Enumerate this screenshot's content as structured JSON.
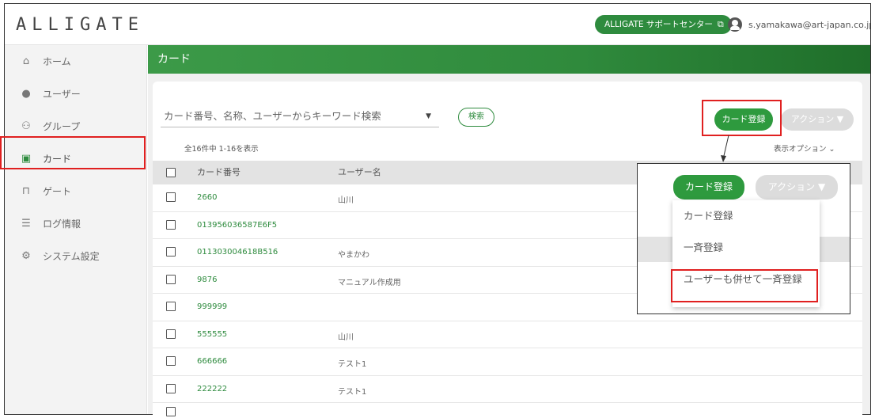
{
  "header": {
    "logo": "ALLIGATE",
    "support_label": "ALLIGATE サポートセンター",
    "user_email": "s.yamakawa@art-japan.co.jp"
  },
  "sidebar": {
    "items": [
      {
        "label": "ホーム",
        "icon": "home-icon"
      },
      {
        "label": "ユーザー",
        "icon": "user-icon"
      },
      {
        "label": "グループ",
        "icon": "group-icon"
      },
      {
        "label": "カード",
        "icon": "card-icon"
      },
      {
        "label": "ゲート",
        "icon": "gate-icon"
      },
      {
        "label": "ログ情報",
        "icon": "list-icon"
      },
      {
        "label": "システム設定",
        "icon": "gear-icon"
      }
    ],
    "active_index": 3
  },
  "page": {
    "title": "カード",
    "search_placeholder": "カード番号、名称、ユーザーからキーワード検索",
    "search_button": "検索",
    "register_button": "カード登録",
    "action_button": "アクション ▼",
    "count_text": "全16件中 1-16を表示",
    "display_options": "表示オプション"
  },
  "table": {
    "columns": [
      "カード番号",
      "ユーザー名"
    ],
    "rows": [
      {
        "card": "2660",
        "user": "山川"
      },
      {
        "card": "013956036587E6F5",
        "user": ""
      },
      {
        "card": "011303004618B516",
        "user": "やまかわ"
      },
      {
        "card": "9876",
        "user": "マニュアル作成用"
      },
      {
        "card": "999999",
        "user": ""
      },
      {
        "card": "555555",
        "user": "山川"
      },
      {
        "card": "666666",
        "user": "テスト1"
      },
      {
        "card": "222222",
        "user": "テスト1"
      }
    ]
  },
  "callout": {
    "register_button": "カード登録",
    "action_button": "アクション ▼",
    "menu": [
      "カード登録",
      "一斉登録",
      "ユーザーも併せて一斉登録"
    ]
  },
  "colors": {
    "accent": "#2e8b3e",
    "highlight": "#e02020"
  }
}
